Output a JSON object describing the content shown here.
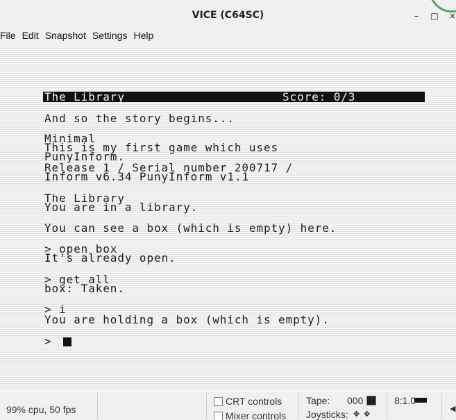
{
  "window": {
    "title": "VICE (C64SC)",
    "minimize_glyph": "–",
    "maximize_glyph": "□",
    "close_glyph": "×"
  },
  "menu": [
    "File",
    "Edit",
    "Snapshot",
    "Settings",
    "Help"
  ],
  "screen": {
    "status_left": "The Library",
    "status_right": "Score: 0/3",
    "lines": [
      "And so the story begins...",
      "Minimal",
      "This is my first game which uses",
      "PunyInform.",
      "Release 1 / Serial number 200717 /",
      "Inform v6.34 PunyInform v1.1",
      "The Library",
      "You are in a library.",
      "You can see a box (which is empty) here.",
      "> open box",
      "It's already open.",
      "> get all",
      "box: Taken.",
      "> i",
      "You are holding a box (which is empty).",
      "> "
    ]
  },
  "statusbar": {
    "perf": "99% cpu, 50 fps",
    "crt_controls": "CRT controls",
    "mixer_controls": "Mixer controls",
    "tape_label": "Tape:",
    "tape_counter": "000",
    "joysticks_label": "Joysticks:",
    "drive": "8:1.0"
  },
  "colors": {
    "chrome": "#f0f0f0",
    "screen_bg": "#ececec",
    "text": "#1e1e1e",
    "status_bg": "#111111",
    "ring": "#5aa06a"
  },
  "icons": {
    "joystick": "joystick-icon",
    "volume": "volume-icon",
    "tape": "tape-icon",
    "drive_led": "drive-led-icon"
  }
}
